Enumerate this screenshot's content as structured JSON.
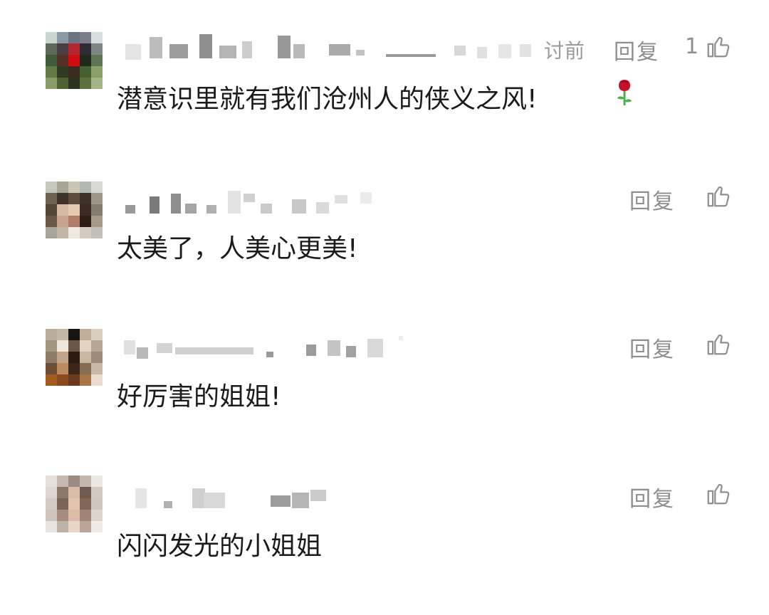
{
  "comments": [
    {
      "time_fragment": "讨前",
      "reply_label": "回复",
      "like_count": "1",
      "text": "潜意识里就有我们沧州人的侠义之风!",
      "emoji": "rose-emoji"
    },
    {
      "reply_label": "回复",
      "like_count": "",
      "text": "太美了，人美心更美!"
    },
    {
      "reply_label": "回复",
      "like_count": "",
      "text": "好厉害的姐姐!"
    },
    {
      "reply_label": "回复",
      "like_count": "",
      "text": "闪闪发光的小姐姐"
    }
  ],
  "icons": {
    "like": "thumbs-up-outline-icon",
    "rose": "rose-emoji"
  },
  "colors": {
    "text": "#1b1b1b",
    "meta": "#8e8e8e",
    "rose_red": "#c8102e",
    "rose_green": "#4caf50"
  }
}
